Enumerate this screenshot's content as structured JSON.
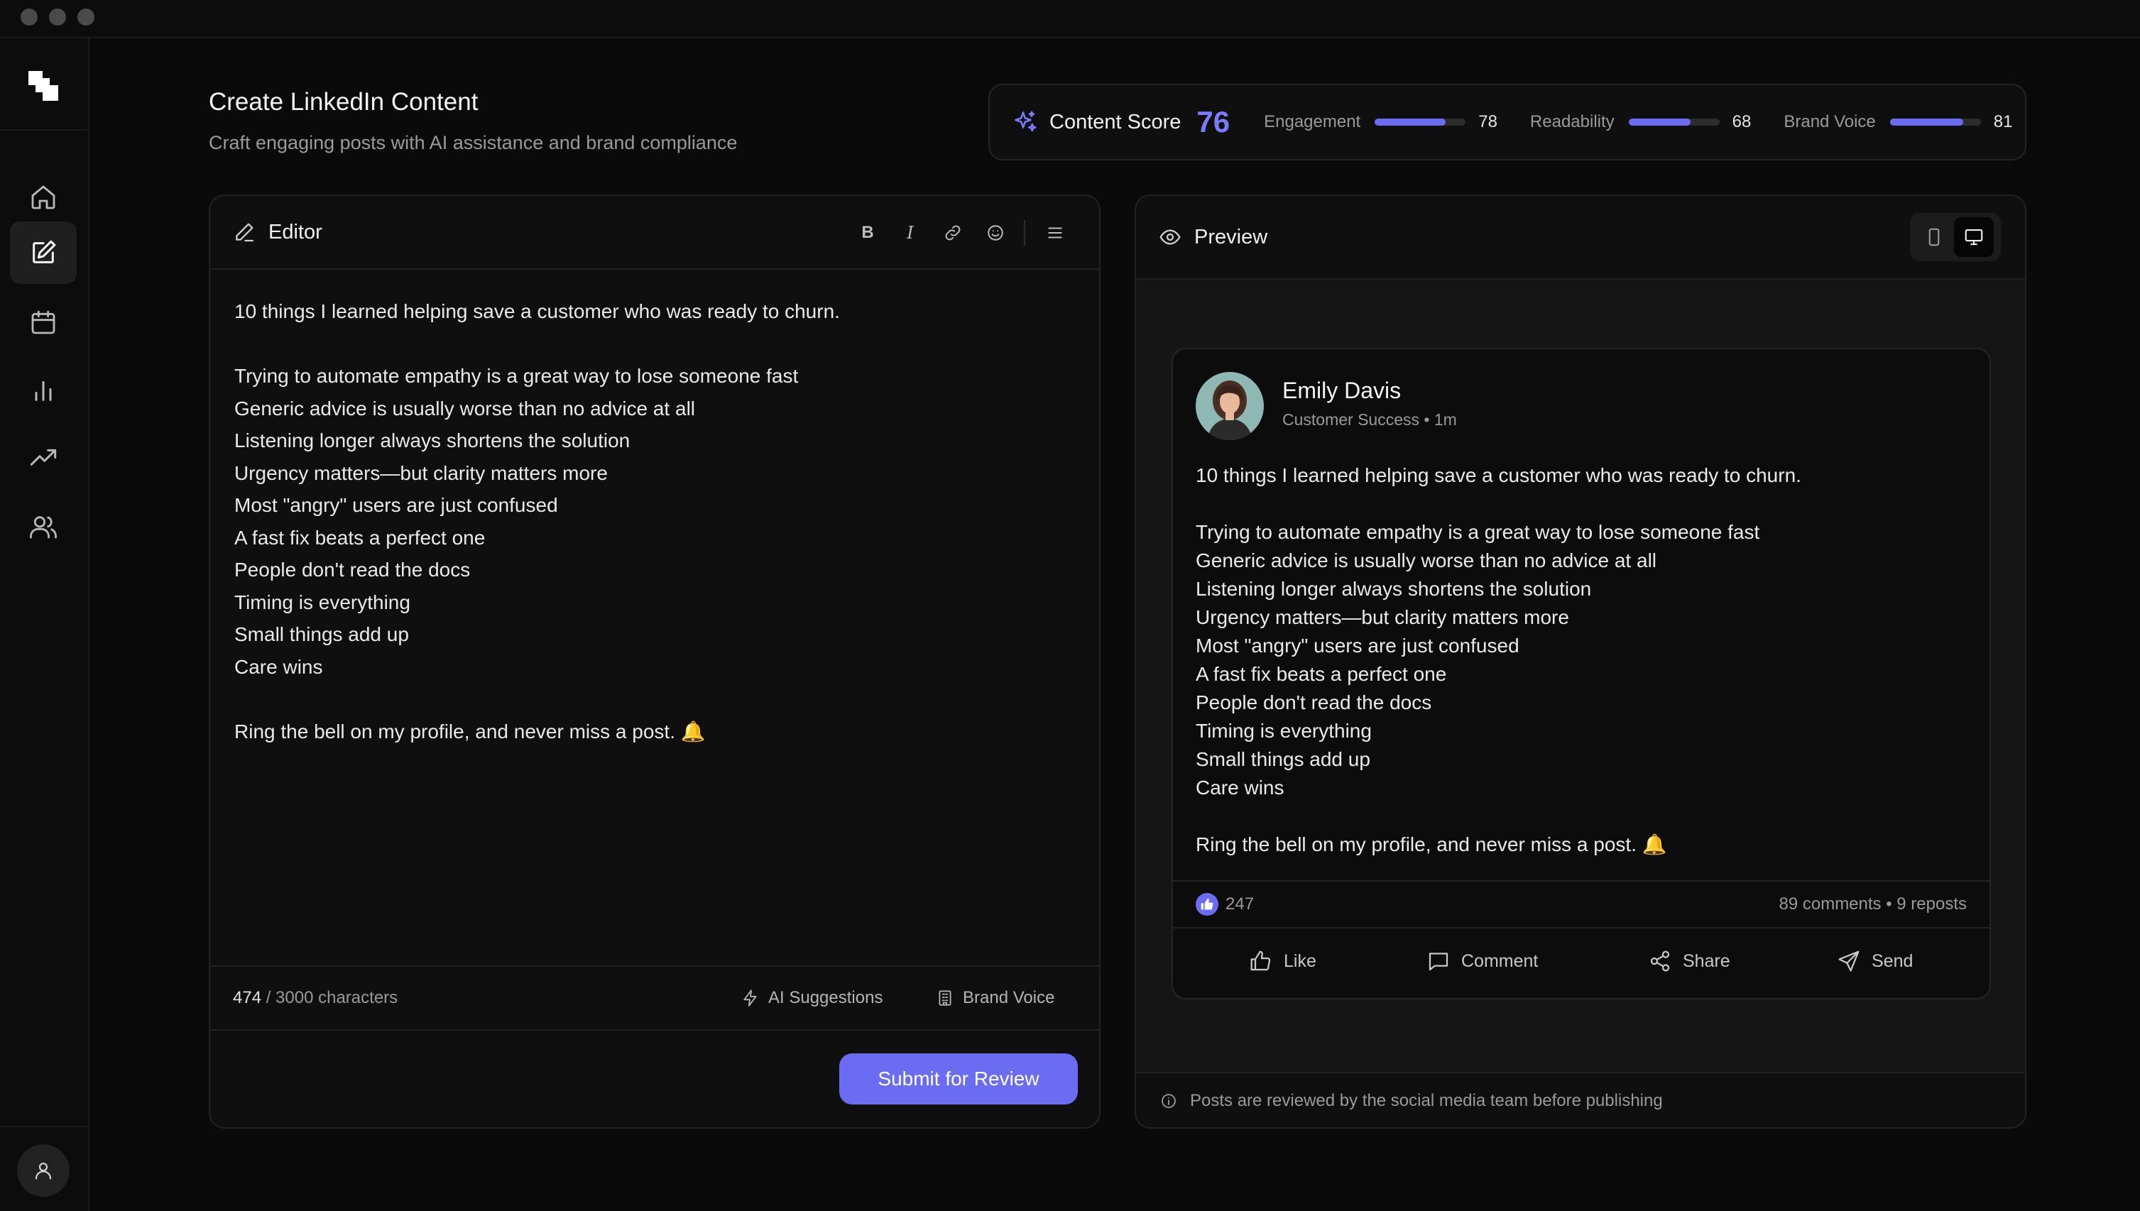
{
  "sidebar": {
    "items": [
      {
        "name": "home",
        "icon": "home-icon",
        "active": false
      },
      {
        "name": "create",
        "icon": "pencil-square-icon",
        "active": true
      },
      {
        "name": "calendar",
        "icon": "calendar-icon",
        "active": false
      },
      {
        "name": "analytics",
        "icon": "bar-chart-icon",
        "active": false
      },
      {
        "name": "trends",
        "icon": "trending-up-icon",
        "active": false
      },
      {
        "name": "team",
        "icon": "users-icon",
        "active": false
      }
    ],
    "user_icon": "user-icon"
  },
  "header": {
    "title": "Create LinkedIn Content",
    "subtitle": "Craft engaging posts with AI assistance and brand compliance"
  },
  "score": {
    "label": "Content Score",
    "value": "76",
    "metrics": [
      {
        "label": "Engagement",
        "value": "78",
        "percent": 78
      },
      {
        "label": "Readability",
        "value": "68",
        "percent": 68
      },
      {
        "label": "Brand Voice",
        "value": "81",
        "percent": 81
      }
    ],
    "accent": "#6a6cf2"
  },
  "editor": {
    "title": "Editor",
    "toolbar": {
      "bold": "B",
      "italic": "I"
    },
    "content": "10 things I learned helping save a customer who was ready to churn.\n\nTrying to automate empathy is a great way to lose someone fast\nGeneric advice is usually worse than no advice at all\nListening longer always shortens the solution\nUrgency matters—but clarity matters more\nMost \"angry\" users are just confused\nA fast fix beats a perfect one\nPeople don't read the docs\nTiming is everything\nSmall things add up\nCare wins\n\nRing the bell on my profile, and never miss a post. 🔔",
    "char_count": "474",
    "char_limit": "/ 3000 characters",
    "ai_suggestions_label": "AI Suggestions",
    "brand_voice_label": "Brand Voice",
    "submit_label": "Submit for Review"
  },
  "preview": {
    "title": "Preview",
    "author": "Emily Davis",
    "meta": "Customer Success • 1m",
    "content": "10 things I learned helping save a customer who was ready to churn.\n\nTrying to automate empathy is a great way to lose someone fast\nGeneric advice is usually worse than no advice at all\nListening longer always shortens the solution\nUrgency matters—but clarity matters more\nMost \"angry\" users are just confused\nA fast fix beats a perfect one\nPeople don't read the docs\nTiming is everything\nSmall things add up\nCare wins\n\nRing the bell on my profile, and never miss a post. 🔔",
    "likes": "247",
    "stats": "89 comments • 9 reposts",
    "actions": {
      "like": "Like",
      "comment": "Comment",
      "share": "Share",
      "send": "Send"
    },
    "note": "Posts are reviewed by the social media team before publishing"
  }
}
